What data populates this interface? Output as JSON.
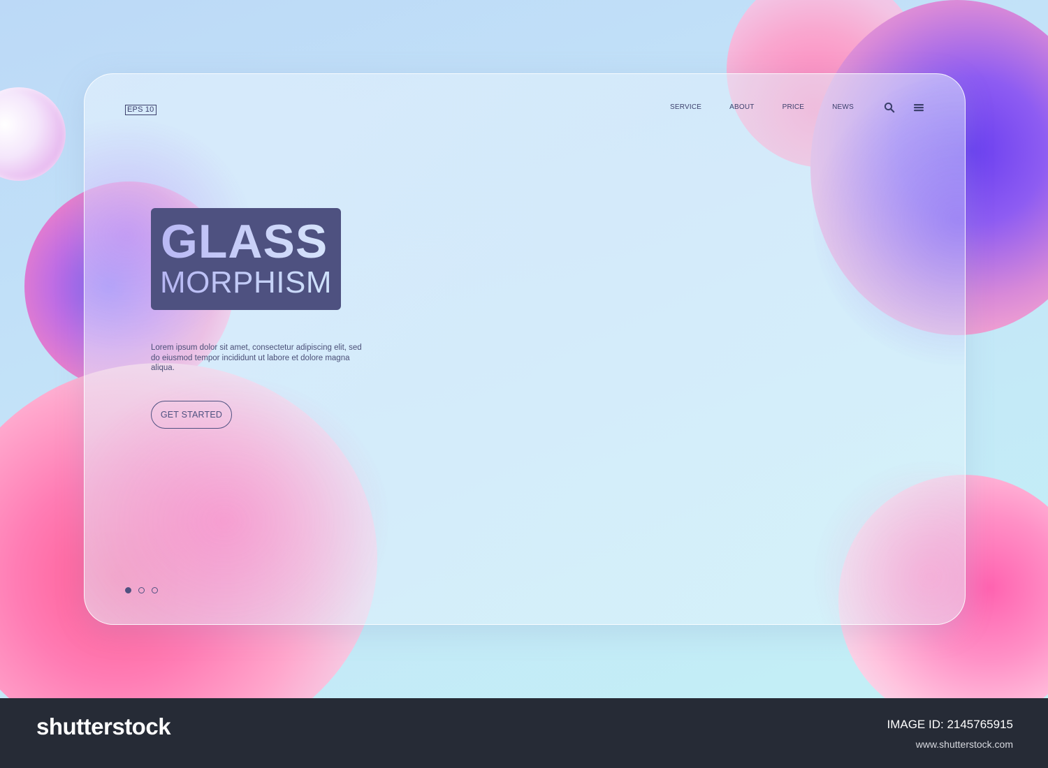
{
  "header": {
    "logo": "EPS 10",
    "nav": [
      "SERVICE",
      "ABOUT",
      "PRICE",
      "NEWS"
    ]
  },
  "hero": {
    "title_line1": "GLASS",
    "title_line2": "MORPHISM",
    "description": "Lorem ipsum dolor sit amet, consectetur adipiscing elit, sed do eiusmod tempor incididunt ut labore et dolore magna aliqua.",
    "cta_label": "GET STARTED"
  },
  "carousel": {
    "count": 3,
    "active": 1
  },
  "icons": {
    "search": "search-icon",
    "menu": "menu-icon"
  },
  "colors": {
    "primary": "#4e5180",
    "text": "#3b3f6b",
    "footer_bg": "#262b36"
  },
  "footer": {
    "brand": "shutterstock",
    "image_id": "IMAGE ID: 2145765915",
    "site": "www.shutterstock.com"
  }
}
